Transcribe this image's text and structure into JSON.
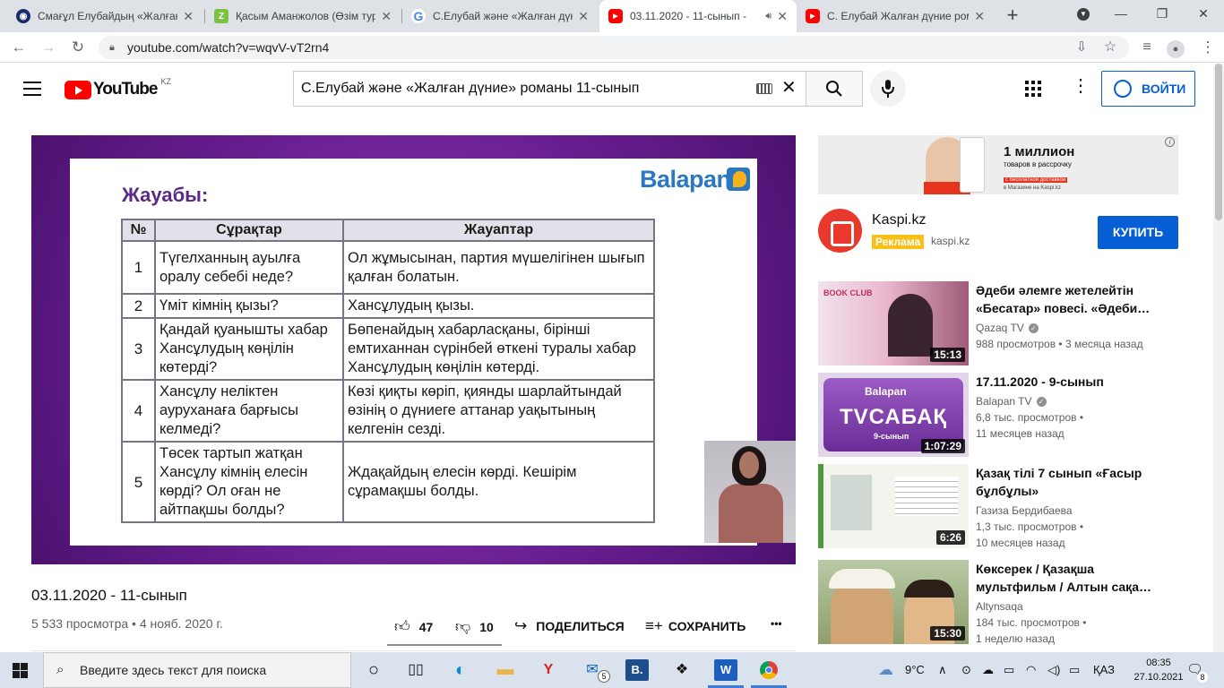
{
  "browser": {
    "tabs": [
      {
        "title": "Смағұл Елубайдың «Жалған",
        "favicon": "site-icon",
        "favcolor": "#1b2a6b",
        "active": false
      },
      {
        "title": "Қасым Аманжолов (Өзім тур",
        "favicon": "z-icon",
        "favcolor": "#7cc242",
        "active": false
      },
      {
        "title": "С.Елубай және «Жалған дүн",
        "favicon": "google-icon",
        "favcolor": "#4285f4",
        "active": false
      },
      {
        "title": "03.11.2020 - 11-сынып -",
        "favicon": "youtube-icon",
        "favcolor": "#ff0000",
        "active": true
      },
      {
        "title": "С. Елубай Жалған дүние ром",
        "favicon": "youtube-icon",
        "favcolor": "#ff0000",
        "active": false
      }
    ],
    "url": "youtube.com/watch?v=wqvV-vT2rn4"
  },
  "yt": {
    "logo_text": "YouTube",
    "country": "KZ",
    "search_value": "С.Елубай және «Жалған дүние» романы 11-сынып",
    "signin_label": "ВОЙТИ"
  },
  "slide": {
    "title": "Жауабы:",
    "brand": "Balapan",
    "headers": [
      "№",
      "Сұрақтар",
      "Жауаптар"
    ],
    "rows": [
      {
        "n": "1",
        "q": "Түгелханның ауылға оралу себебі неде?",
        "a": "Ол жұмысынан, партия мүшелігінен шығып қалған болатын."
      },
      {
        "n": "2",
        "q": "Үміт кімнің қызы?",
        "a": "Хансұлудың қызы."
      },
      {
        "n": "3",
        "q": "Қандай қуанышты хабар Хансұлудың көңілін көтерді?",
        "a": "Бөпенайдың хабарласқаны, бірінші емтиханнан сүрінбей өткені туралы хабар Хансұлудың көңілін көтерді."
      },
      {
        "n": "4",
        "q": "Хансұлу неліктен ауруханаға барғысы келмеді?",
        "a": "Көзі қиқты көріп, қиянды шарлайтындай өзінің о дүниеге аттанар уақытының келгенін сезді."
      },
      {
        "n": "5",
        "q": "Төсек тартып жатқан Хансұлу кімнің елесін көрді? Ол оған не айтпақшы болды?",
        "a": "Ждақайдың елесін көрді. Кешірім сұрамақшы болды."
      }
    ]
  },
  "video": {
    "title": "03.11.2020 - 11-сынып",
    "meta": "5 533 просмотра • 4 нояб. 2020 г.",
    "likes": "47",
    "dislikes": "10",
    "share": "ПОДЕЛИТЬСЯ",
    "save": "СОХРАНИТЬ",
    "more": "•••"
  },
  "ad": {
    "banner_title": "1 миллион",
    "banner_sub": "товаров в рассрочку",
    "banner_promo": "с бесплатной доставкой",
    "banner_note": "в Магазине на Kaspi.kz",
    "name": "Kaspi.kz",
    "badge": "Реклама",
    "domain": "kaspi.kz",
    "button": "КУПИТЬ"
  },
  "recs": [
    {
      "title": "Әдеби әлемге жетелейтін «Бесатар» повесі. «Әдеби…",
      "channel": "Qazaq TV",
      "verified": true,
      "views": "988 просмотров • 3 месяца назад",
      "views2": "",
      "duration": "15:13",
      "thumb_color": "#d95d7a"
    },
    {
      "title": "17.11.2020 - 9-сынып",
      "channel": "Balapan TV",
      "verified": true,
      "views": "6,8 тыс. просмотров •",
      "views2": "11 месяцев назад",
      "duration": "1:07:29",
      "thumb_color": "#7b3fa6"
    },
    {
      "title": "Қазақ тілі 7 сынып «Ғасыр бұлбұлы»",
      "channel": "Газиза Бердибаева",
      "verified": false,
      "views": "1,3 тыс. просмотров •",
      "views2": "10 месяцев назад",
      "duration": "6:26",
      "thumb_color": "#4d9a3b"
    },
    {
      "title": "Көксерек / Қазақша мультфильм / Алтын сақа…",
      "channel": "Altynsaqa",
      "verified": false,
      "views": "184 тыс. просмотров •",
      "views2": "1 неделю назад",
      "duration": "15:30",
      "thumb_color": "#c79b5c"
    }
  ],
  "taskbar": {
    "search_placeholder": "Введите здесь текст для поиска",
    "weather": "9°C",
    "lang": "ҚАЗ",
    "time": "08:35",
    "date": "27.10.2021",
    "notif_count": "8",
    "mail_badge": "5"
  }
}
